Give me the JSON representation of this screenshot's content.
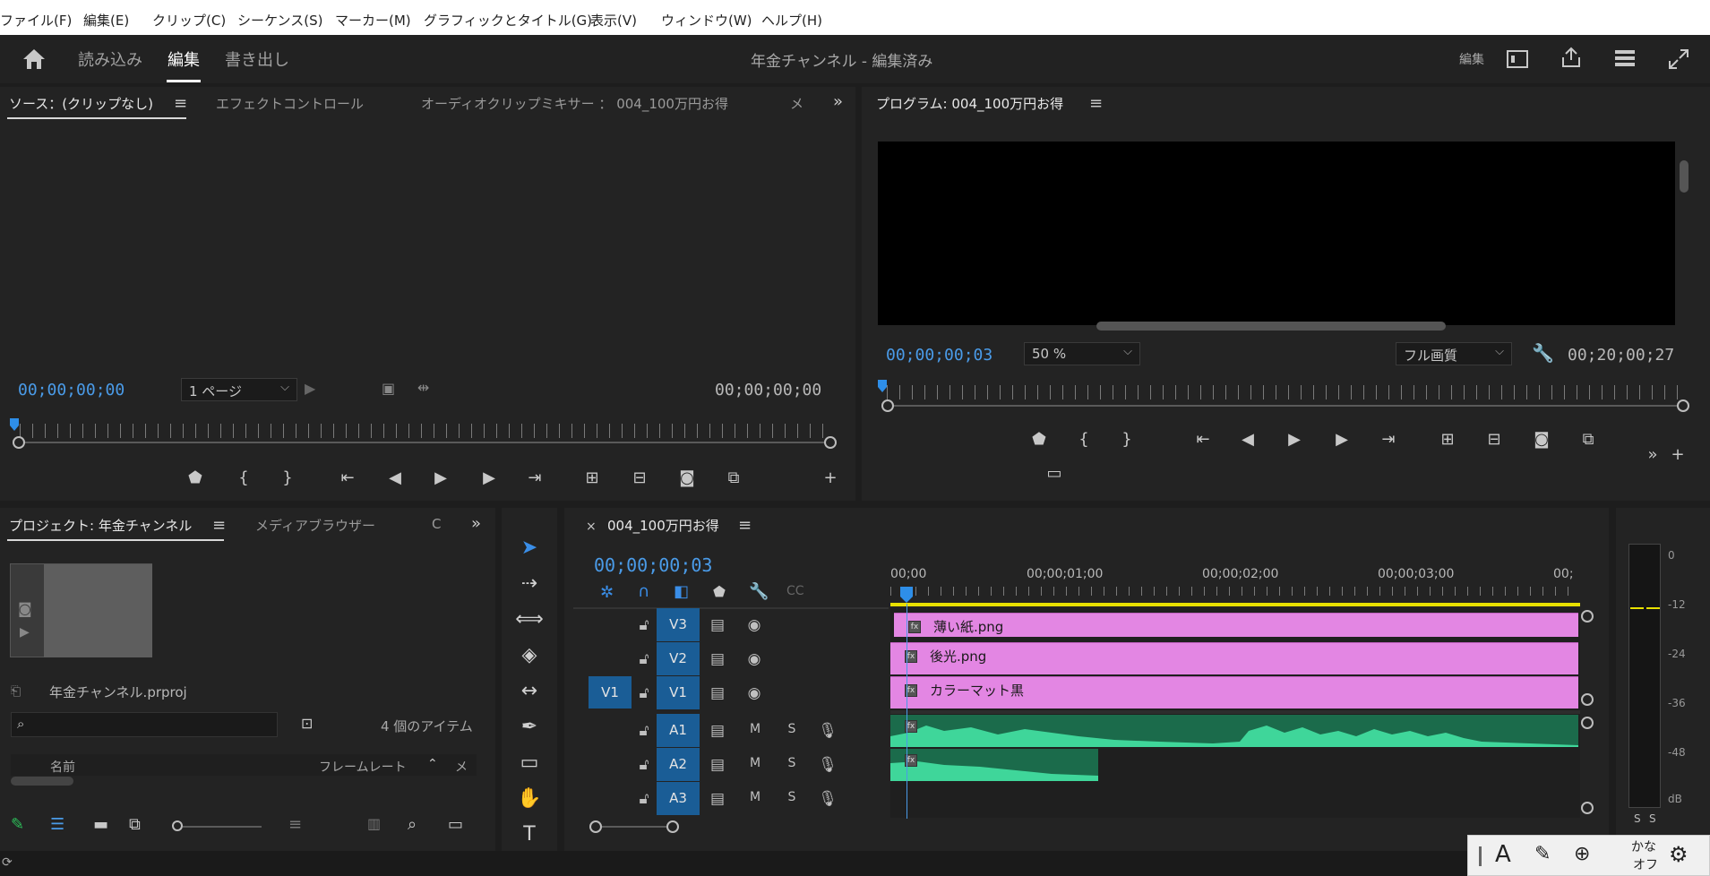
{
  "menu": [
    "ファイル(F)",
    "編集(E)",
    "クリップ(C)",
    "シーケンス(S)",
    "マーカー(M)",
    "グラフィックとタイトル(G)",
    "表示(V)",
    "ウィンドウ(W)",
    "ヘルプ(H)"
  ],
  "workspaces": {
    "import": "読み込み",
    "edit": "編集",
    "export": "書き出し"
  },
  "doc_title": "年金チャンネル - 編集済み",
  "top_right_label": "編集",
  "source": {
    "tabs": [
      "ソース：(クリップなし)",
      "エフェクトコントロール",
      "オーディオクリップミキサー ： 004_100万円お得",
      "メ"
    ],
    "timecode_in": "00;00;00;00",
    "timecode_out": "00;00;00;00",
    "page_select": "1 ページ"
  },
  "program": {
    "title": "プログラム: 004_100万円お得",
    "timecode": "00;00;00;03",
    "zoom": "50 %",
    "quality": "フル画質",
    "duration": "00;20;00;27"
  },
  "project": {
    "tabs": [
      "プロジェクト: 年金チャンネル",
      "メディアブラウザー",
      "C"
    ],
    "file": "年金チャンネル.prproj",
    "item_count": "4 個のアイテム",
    "col_name": "名前",
    "col_framerate": "フレームレート",
    "col_media": "メ"
  },
  "timeline": {
    "sequence": "004_100万円お得",
    "timecode": "00;00;00;03",
    "ruler": [
      "00;00",
      "00;00;01;00",
      "00;00;02;00",
      "00;00;03;00",
      "00;"
    ],
    "src_patch": "V1",
    "video_tracks": [
      {
        "name": "V3",
        "clip": "薄い紙.png"
      },
      {
        "name": "V2",
        "clip": "後光.png"
      },
      {
        "name": "V1",
        "clip": "カラーマット黒"
      }
    ],
    "audio_tracks": [
      {
        "name": "A1",
        "m": "M",
        "s": "S"
      },
      {
        "name": "A2",
        "m": "M",
        "s": "S"
      },
      {
        "name": "A3",
        "m": "M",
        "s": "S"
      }
    ]
  },
  "meter": {
    "labels": [
      "0",
      "-12",
      "-24",
      "-36",
      "-48",
      "dB"
    ],
    "solo": [
      "S",
      "S"
    ]
  },
  "ime": {
    "mode": "かな",
    "state": "オフ"
  }
}
